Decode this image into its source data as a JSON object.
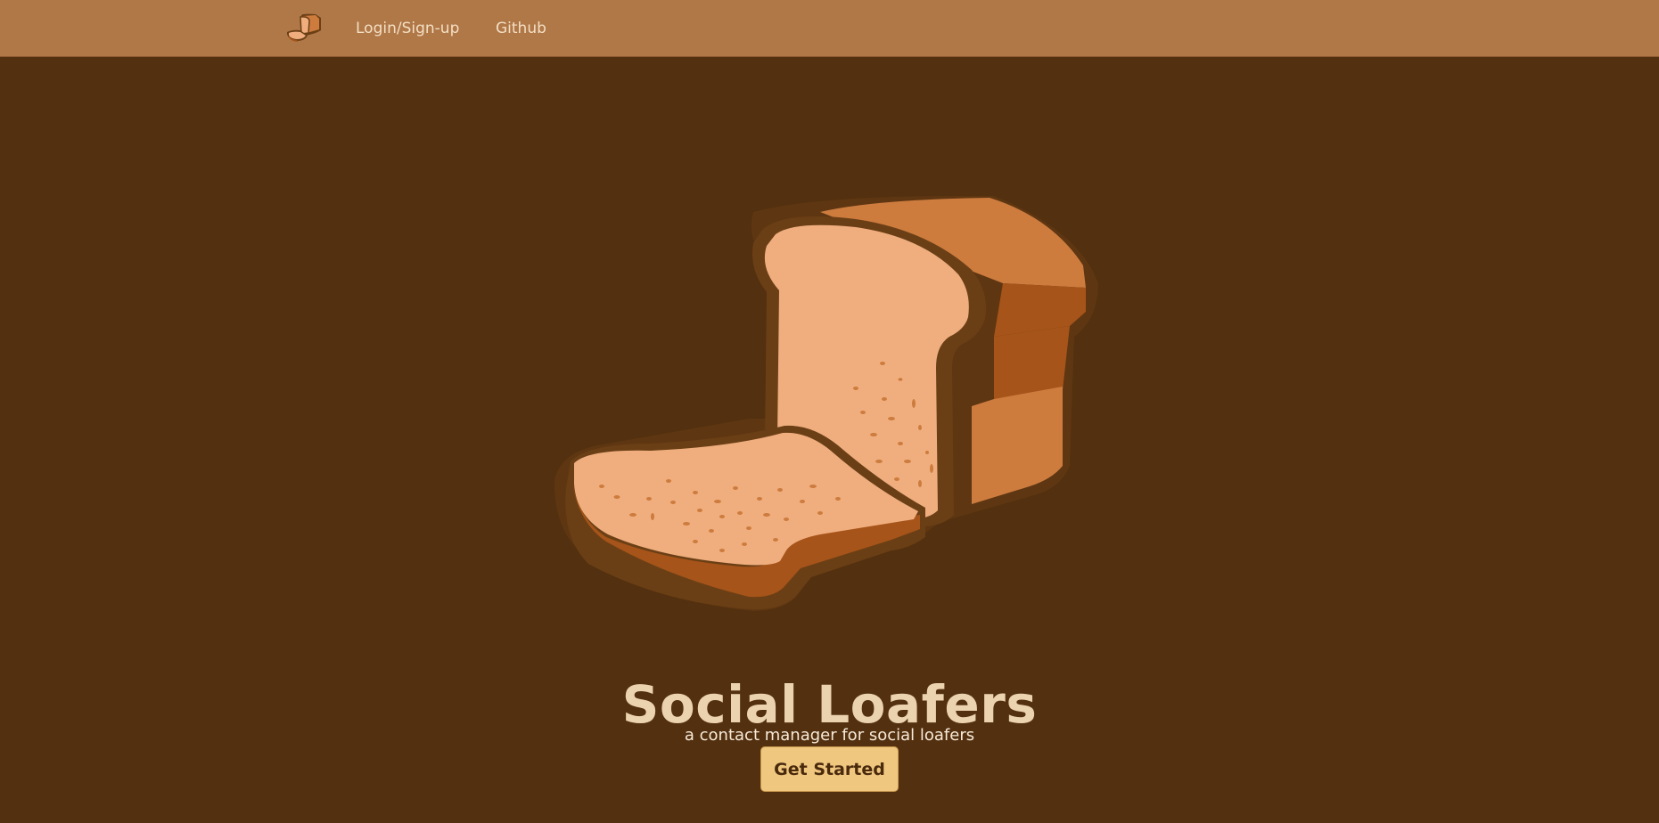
{
  "nav": {
    "logo_icon": "bread-loaf-icon",
    "login_label": "Login/Sign-up",
    "github_label": "Github"
  },
  "hero": {
    "image_icon": "bread-loaf-illustration",
    "title": "Social Loafers",
    "subtitle": "a contact manager for social loafers",
    "cta_label": "Get Started"
  },
  "colors": {
    "navbar": "#b07747",
    "background": "#53300f",
    "title": "#ecd3b0",
    "cta": "#f0c77f",
    "crust": "#cd7c3e",
    "crumb": "#f0ae7e",
    "outline": "#6b3f15"
  }
}
